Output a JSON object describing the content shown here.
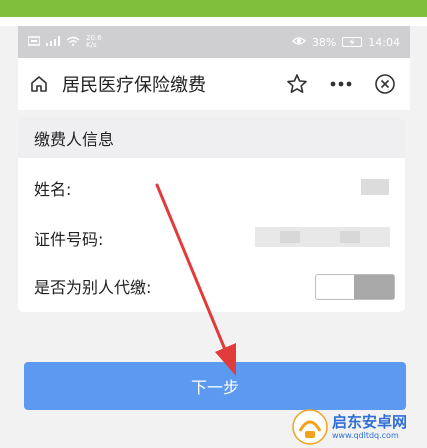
{
  "status_bar": {
    "speed_value": "20.6",
    "speed_unit": "K/s",
    "battery_percent": "38%",
    "time": "14:04"
  },
  "header": {
    "title": "居民医疗保险缴费"
  },
  "payer_section": {
    "heading": "缴费人信息",
    "name_label": "姓名:",
    "id_label": "证件号码:",
    "proxy_label": "是否为别人代缴:",
    "proxy_enabled": false
  },
  "actions": {
    "next_label": "下一步"
  },
  "watermark": {
    "name": "启东安卓网",
    "url": "www.qdltdq.com"
  },
  "colors": {
    "accent": "#5b9af0",
    "top_band": "#7fbf3b",
    "annotation_arrow": "#e23b3b"
  }
}
